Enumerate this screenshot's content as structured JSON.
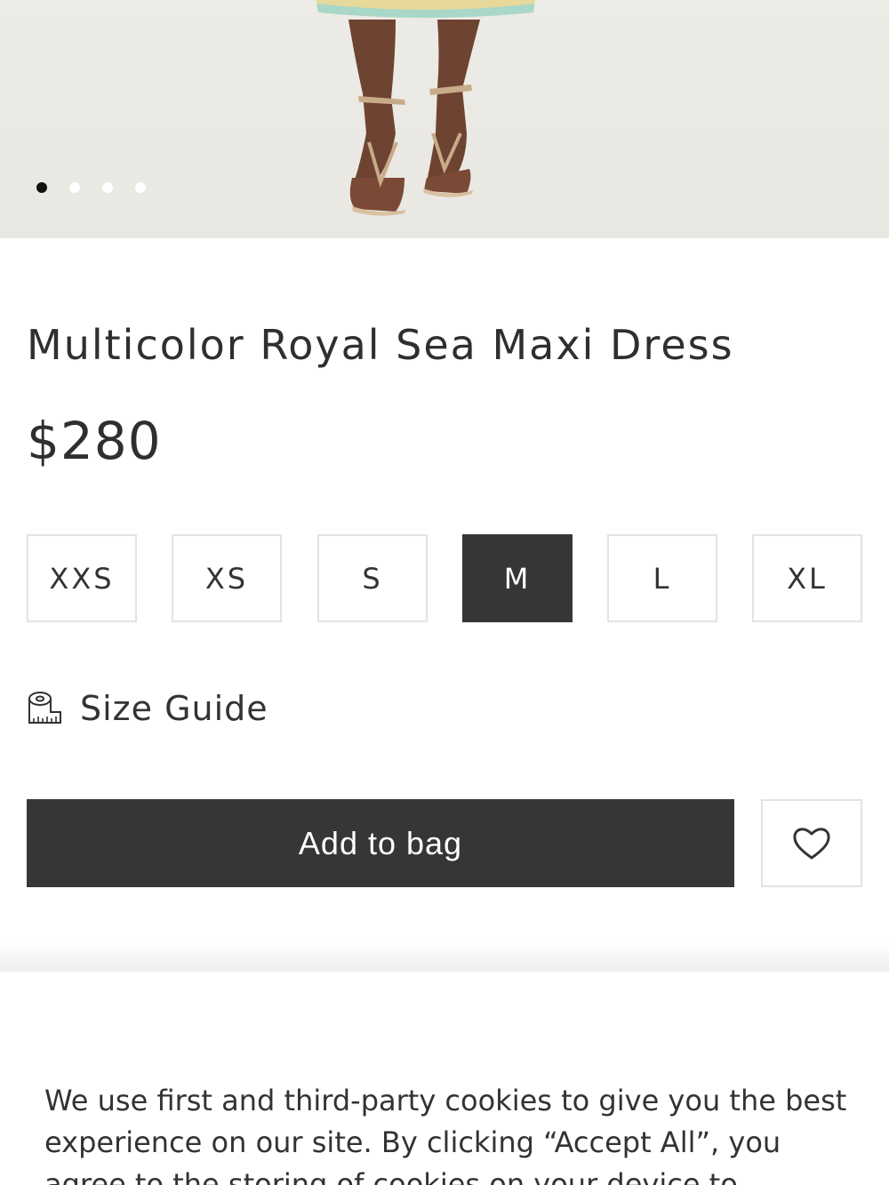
{
  "product": {
    "title": "Multicolor Royal Sea Maxi Dress",
    "price": "$280",
    "image_count": 4,
    "active_image": 1
  },
  "sizes": [
    {
      "label": "XXS",
      "selected": false
    },
    {
      "label": "XS",
      "selected": false
    },
    {
      "label": "S",
      "selected": false
    },
    {
      "label": "M",
      "selected": true
    },
    {
      "label": "L",
      "selected": false
    },
    {
      "label": "XL",
      "selected": false
    }
  ],
  "size_guide": {
    "label": "Size Guide",
    "icon": "measuring-tape-icon"
  },
  "actions": {
    "add_to_bag": "Add to bag",
    "wishlist_icon": "heart-icon"
  },
  "cookie_banner": {
    "text": "We use first and third-party cookies to give you the best experience on our site. By clicking “Accept All”, you agree to the storing of cookies on your device to"
  },
  "colors": {
    "dark": "#363636",
    "border": "#e3e3e3"
  }
}
